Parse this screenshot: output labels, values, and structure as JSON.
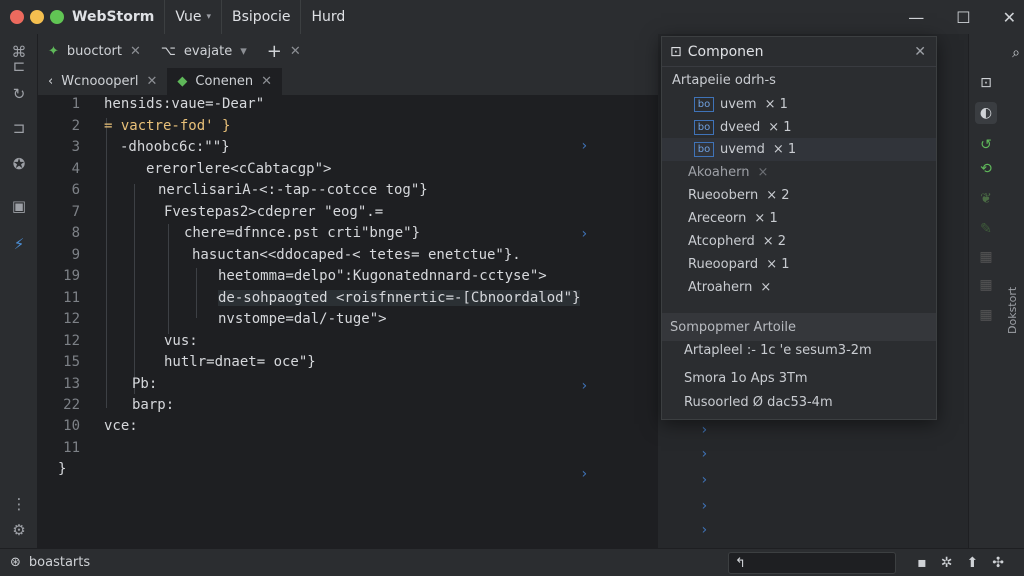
{
  "titlebar": {
    "app": "WebStorm",
    "menu1": "Vue",
    "menu2": "Bsipocie",
    "menu3": "Hurd",
    "colors": {
      "red": "#ec6a5e",
      "yellow": "#f4bf4f",
      "green": "#61c554"
    }
  },
  "tabs_top": [
    {
      "label": "buoctort",
      "icon": "vue-icon"
    },
    {
      "label": "evajate",
      "icon": "code-icon"
    }
  ],
  "tabs_editor": [
    {
      "label": "Wcnoooperl"
    },
    {
      "label": "Conenen",
      "icon": "vue-icon"
    }
  ],
  "editor": {
    "lines": [
      {
        "n": "1",
        "text": "hensids:vaue=-Dear\""
      },
      {
        "n": "2",
        "text": "= vactre-fod' }"
      },
      {
        "n": "3",
        "text": "-dhoobc6c:\"\"}"
      },
      {
        "n": "4",
        "text": "ererorlere<cCabtacgp\">"
      },
      {
        "n": "6",
        "text": "nerclisariA-<:-tap--cotcce tog\"}"
      },
      {
        "n": "7",
        "text": "Fvestepas2>cdeprer \"eog\".="
      },
      {
        "n": "8",
        "text": "chere=dfnnce.pst crti\"bnge\"}"
      },
      {
        "n": "9",
        "text": "hasuctan<<ddocaped-< tetes= enetctue\"}."
      },
      {
        "n": "19",
        "text": "heetomma=delpo\":Kugonatednnard-cctyse\">"
      },
      {
        "n": "11",
        "text": "de-sohpaogted <roisfnnertic=-[Cbnoordalod\"}"
      },
      {
        "n": "12",
        "text": "nvstompe=dal/-tuge\">"
      },
      {
        "n": "12",
        "text": "vus:"
      },
      {
        "n": "15",
        "text": "hutlr=dnaet= oce\"}"
      },
      {
        "n": "13",
        "text": "Pb:"
      },
      {
        "n": "22",
        "text": "barp:"
      },
      {
        "n": "10",
        "text": "vce:"
      },
      {
        "n": "11",
        "text": ""
      },
      {
        "n": "",
        "text": "}"
      }
    ]
  },
  "popup": {
    "title": "Componen",
    "subtitle": "Artapeiie odrh-s",
    "items": [
      {
        "label": "uvem",
        "count": "1",
        "tag": "bo"
      },
      {
        "label": "dveed",
        "count": "1",
        "tag": "bo"
      },
      {
        "label": "uvemd",
        "count": "1",
        "tag": "bo"
      },
      {
        "label": "Akoahern",
        "count": "",
        "dim": true
      },
      {
        "label": "Rueoobern",
        "count": "2"
      },
      {
        "label": "Areceorn",
        "count": "1"
      },
      {
        "label": "Atcopherd",
        "count": "2"
      },
      {
        "label": "Rueoopard",
        "count": "1"
      },
      {
        "label": "Atroahern",
        "count": ""
      }
    ],
    "section": "Sompopmer Artoile",
    "details": [
      "Artapleel :- 1c 'e sesum3-2m",
      "Smora  1o Aps 3Tm",
      "Rusoorled Ø dac53-4m"
    ]
  },
  "rstrip": {
    "vertical_label": "Dokstort"
  },
  "status": {
    "label": "boastarts",
    "field": "↰"
  }
}
